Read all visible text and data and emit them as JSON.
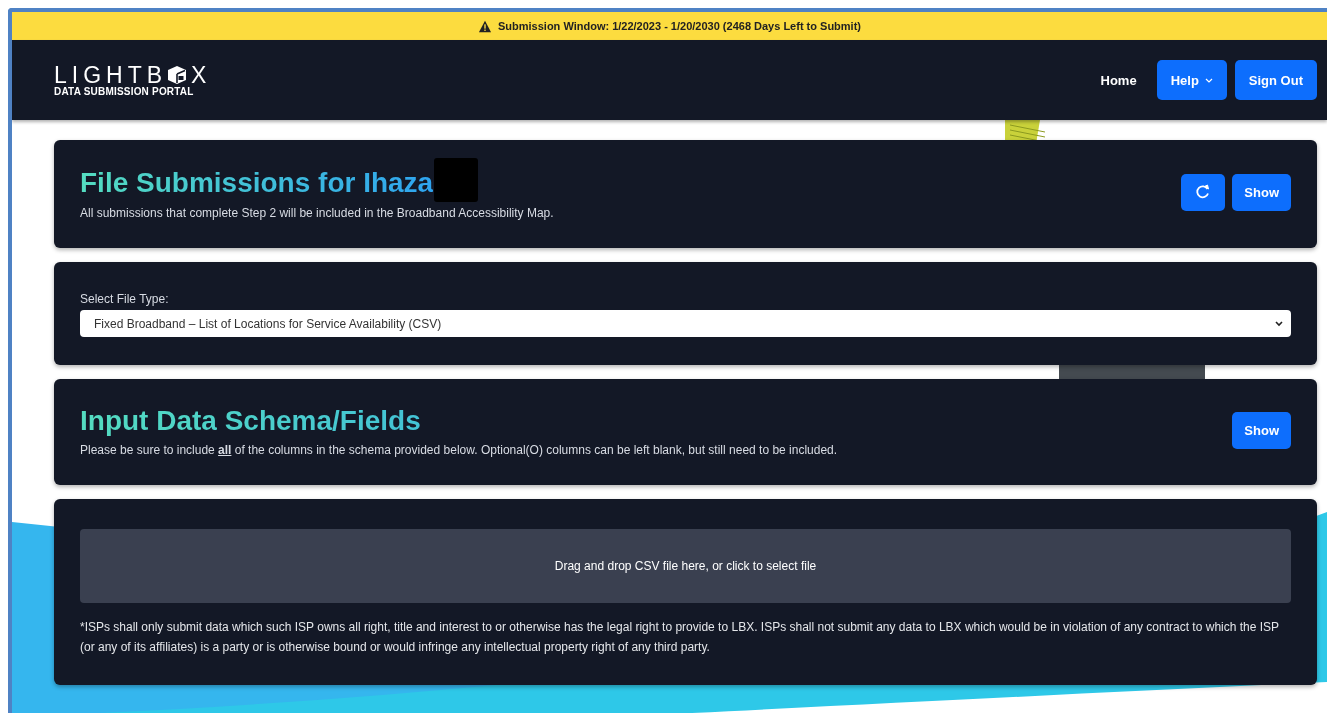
{
  "banner": {
    "text": "Submission Window: 1/22/2023 - 1/20/2030 (2468 Days Left to Submit)"
  },
  "navbar": {
    "logo_word": "LIGHTB",
    "logo_word_end": "X",
    "logo_subtitle": "DATA SUBMISSION PORTAL",
    "links": [
      {
        "label": "Home",
        "kind": "link"
      },
      {
        "label": "Help",
        "kind": "dropdown"
      },
      {
        "label": "Sign Out",
        "kind": "button"
      }
    ]
  },
  "submissions": {
    "title": "File Submissions for Ihaza",
    "redacted": true,
    "description": "All submissions that complete Step 2 will be included in the Broadband Accessibility Map.",
    "show_button": "Show"
  },
  "file_type": {
    "label": "Select File Type:",
    "value": "Fixed Broadband – List of Locations for Service Availability (CSV)"
  },
  "schema": {
    "title": "Input Data Schema/Fields",
    "description": "Please be sure to include **all** of the columns in the schema provided below. Optional(O) columns can be left blank, but still need to be included.",
    "show_button": "Show"
  },
  "upload": {
    "dropzone": "Drag and drop CSV file here, or click to select file",
    "disclaimer": "*ISPs shall only submit data which such ISP owns all right, title and interest to or otherwise has the legal right to provide to LBX. ISPs shall not submit any data to LBX which would be in violation of any contract to which the ISP (or any of its affiliates) is a party or is otherwise bound or would infringe any intellectual property right of any third party."
  }
}
